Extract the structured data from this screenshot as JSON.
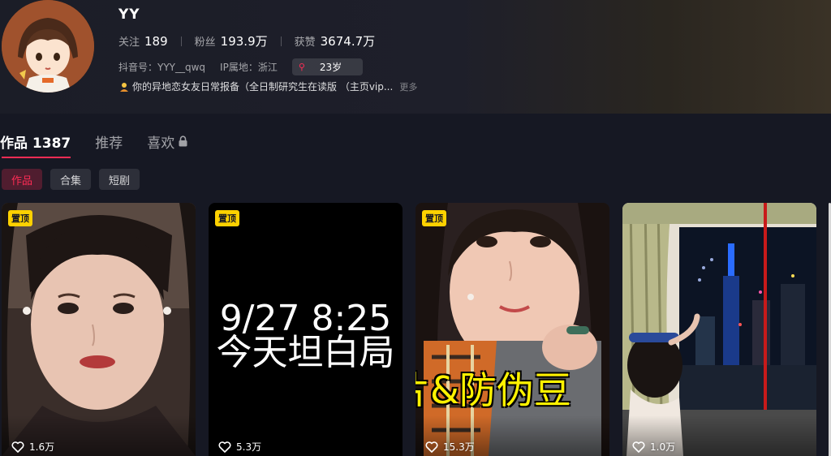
{
  "profile": {
    "username": "YY",
    "stats": [
      {
        "label": "关注",
        "value": "189"
      },
      {
        "label": "粉丝",
        "value": "193.9万"
      },
      {
        "label": "获赞",
        "value": "3674.7万"
      }
    ],
    "douyin_id": "抖音号：YYY__qwq",
    "ip_location": "IP属地：浙江",
    "age": "23岁",
    "bio": "你的异地恋女友日常报备（全日制研究生在读版 （主页vip...",
    "bio_more": "更多"
  },
  "tabs": [
    {
      "label": "作品 1387"
    },
    {
      "label": "推荐"
    },
    {
      "label": "喜欢"
    }
  ],
  "chips": [
    {
      "label": "作品"
    },
    {
      "label": "合集"
    },
    {
      "label": "短剧"
    }
  ],
  "videos": [
    {
      "pin": "置顶",
      "likes": "1.6万"
    },
    {
      "pin": "置顶",
      "likes": "5.3万",
      "overlay_line1": "9/27 8:25",
      "overlay_line2": "今天坦白局"
    },
    {
      "pin": "置顶",
      "likes": "15.3万",
      "overlay": "片&防伪豆"
    },
    {
      "likes": "1.0万"
    }
  ],
  "colors": {
    "accent": "#fe2c55",
    "pin": "#fdd100",
    "background": "#161823"
  }
}
